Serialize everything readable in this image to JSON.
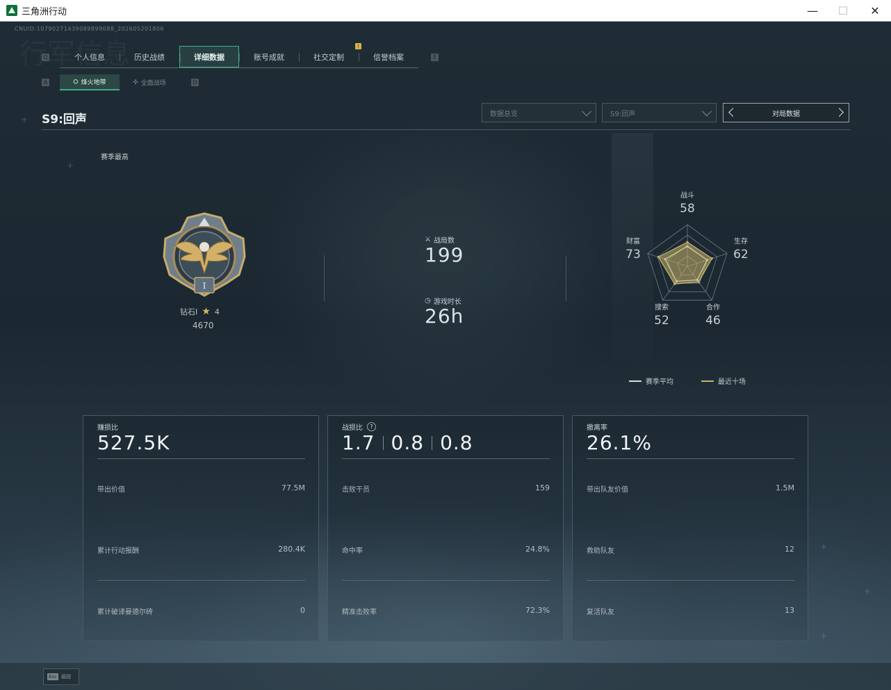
{
  "window": {
    "title": "三角洲行动",
    "minimize": "—",
    "maximize": "☐",
    "close": "✕"
  },
  "cnuid": "CNUID:10790271439089899088_202605201806",
  "watermark": "行军信息",
  "tabs": {
    "key_left": "Q",
    "key_right": "E",
    "items": [
      {
        "label": "个人信息"
      },
      {
        "label": "历史战绩"
      },
      {
        "label": "详细数据",
        "active": true
      },
      {
        "label": "账号成就"
      },
      {
        "label": "社交定制"
      },
      {
        "label": "信誉档案",
        "badge": "!"
      }
    ]
  },
  "subtabs": {
    "key_left": "A",
    "key_right": "D",
    "items": [
      {
        "label": "烽火地带",
        "icon": "operations-icon",
        "active": true
      },
      {
        "label": "全面战场",
        "icon": "warfare-icon"
      }
    ]
  },
  "season_title": "S9:回声",
  "filters": {
    "data_type": "数据总览",
    "season": "S9:回声",
    "match_data": "对局数据"
  },
  "season_best": "赛季最高",
  "rank": {
    "name": "钻石I",
    "stars": "4",
    "score": "4670"
  },
  "stats": {
    "matches_label": "战局数",
    "matches_value": "199",
    "playtime_label": "游戏时长",
    "playtime_value": "26h"
  },
  "radar": {
    "axes": [
      {
        "label": "战斗",
        "value": "58"
      },
      {
        "label": "生存",
        "value": "62"
      },
      {
        "label": "合作",
        "value": "46"
      },
      {
        "label": "搜索",
        "value": "52"
      },
      {
        "label": "财富",
        "value": "73"
      }
    ],
    "recent": [
      58,
      62,
      46,
      52,
      73
    ],
    "season_avg": [
      48,
      50,
      40,
      44,
      56
    ],
    "legend_avg": "赛季平均",
    "legend_recent": "最近十场",
    "color_avg": "#d8dde0",
    "color_recent": "#c8b46a"
  },
  "cards": [
    {
      "label": "赚损比",
      "value": "527.5K",
      "rows": [
        {
          "label": "带出价值",
          "value": "77.5M"
        },
        {
          "label": "累计行动报酬",
          "value": "280.4K"
        },
        {
          "label": "累计破译曼德尔砖",
          "value": "0"
        }
      ]
    },
    {
      "label": "战损比",
      "help": "?",
      "values": [
        "1.7",
        "0.8",
        "0.8"
      ],
      "rows": [
        {
          "label": "击败干员",
          "value": "159"
        },
        {
          "label": "命中率",
          "value": "24.8%"
        },
        {
          "label": "精准击败率",
          "value": "72.3%"
        }
      ]
    },
    {
      "label": "撤离率",
      "value": "26.1%",
      "rows": [
        {
          "label": "带出队友价值",
          "value": "1.5M"
        },
        {
          "label": "救助队友",
          "value": "12"
        },
        {
          "label": "复活队友",
          "value": "13"
        }
      ]
    }
  ],
  "footer": {
    "esc_key": "Esc",
    "esc_label": "返回"
  }
}
